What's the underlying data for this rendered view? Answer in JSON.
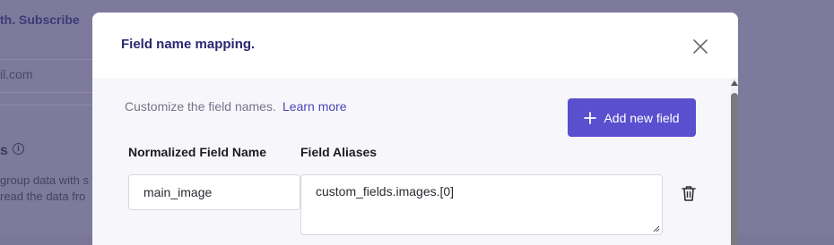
{
  "background": {
    "subscribe_prefix": "th.",
    "subscribe_link": "Subscribe",
    "email_input_value": "il.com",
    "section_heading_fragment": "s",
    "info_icon": "info-icon",
    "description_line1": "group data with s",
    "description_line2": "read the data fro"
  },
  "modal": {
    "title": "Field name mapping.",
    "close_icon": "close-icon",
    "description": "Customize the field names.",
    "learn_more": "Learn more",
    "add_button": {
      "icon": "plus-icon",
      "label": "Add new field"
    },
    "columns": {
      "normalized": "Normalized Field Name",
      "aliases": "Field Aliases"
    },
    "rows": [
      {
        "normalized_value": "main_image",
        "aliases_value": "custom_fields.images.[0]",
        "delete_icon": "trash-icon"
      }
    ]
  },
  "colors": {
    "accent": "#5a4fcf",
    "title": "#2a2870",
    "link": "#4a44b8",
    "overlay": "#7e7a9c"
  }
}
